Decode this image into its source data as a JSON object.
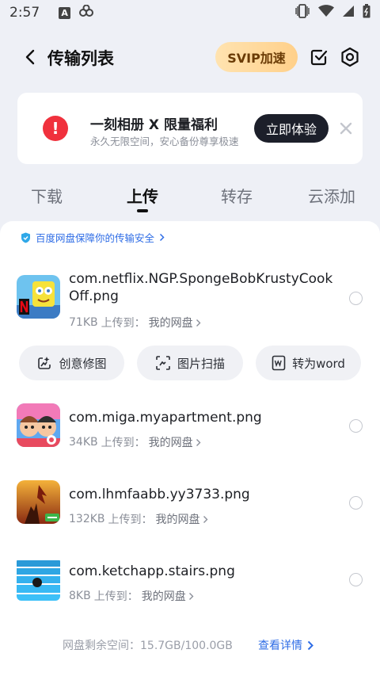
{
  "status_bar": {
    "time": "2:57",
    "left_icons": [
      "a-square-icon",
      "link-icon"
    ],
    "right_icons": [
      "vibrate-icon",
      "wifi-icon",
      "signal-icon",
      "battery-icon"
    ]
  },
  "header": {
    "title": "传输列表",
    "svip_label": "SVIP加速"
  },
  "banner": {
    "title": "一刻相册 X 限量福利",
    "subtitle": "永久无限空间，安心备份尊享极速",
    "button_label": "立即体验"
  },
  "tabs": [
    {
      "label": "下载",
      "active": false
    },
    {
      "label": "上传",
      "active": true
    },
    {
      "label": "转存",
      "active": false
    },
    {
      "label": "云添加",
      "active": false
    }
  ],
  "safe_notice": "百度网盘保障你的传输安全",
  "uploads": [
    {
      "name": "com.netflix.NGP.SpongeBobKrustyCookOff.png",
      "size": "71KB",
      "upload_to_label": "上传到：",
      "destination": "我的网盘"
    },
    {
      "name": "com.miga.myapartment.png",
      "size": "34KB",
      "upload_to_label": "上传到：",
      "destination": "我的网盘"
    },
    {
      "name": "com.lhmfaabb.yy3733.png",
      "size": "132KB",
      "upload_to_label": "上传到：",
      "destination": "我的网盘"
    },
    {
      "name": "com.ketchapp.stairs.png",
      "size": "8KB",
      "upload_to_label": "上传到：",
      "destination": "我的网盘"
    }
  ],
  "actions": [
    {
      "label": "创意修图",
      "icon": "magic-edit-icon"
    },
    {
      "label": "图片扫描",
      "icon": "scan-icon"
    },
    {
      "label": "转为word",
      "icon": "word-icon"
    }
  ],
  "footer": {
    "storage": "网盘剩余空间：15.7GB/100.0GB",
    "detail_link": "查看详情"
  },
  "colors": {
    "accent_blue": "#2f6de6",
    "alert_red": "#f0313d",
    "dark_button": "#1c1f2a",
    "svip_gold": "#ffd08a"
  }
}
